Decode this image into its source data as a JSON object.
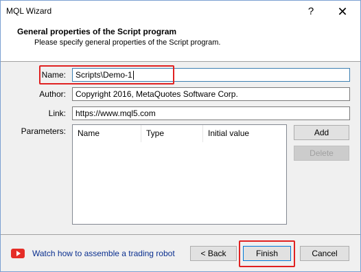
{
  "window": {
    "title": "MQL Wizard",
    "help": "?",
    "close": "✕"
  },
  "header": {
    "title": "General properties of the Script program",
    "subtitle": "Please specify general properties of the Script program."
  },
  "form": {
    "name_label": "Name:",
    "name_value": "Scripts\\Demo-1",
    "author_label": "Author:",
    "author_value": "Copyright 2016, MetaQuotes Software Corp.",
    "link_label": "Link:",
    "link_value": "https://www.mql5.com",
    "parameters_label": "Parameters:"
  },
  "parameters": {
    "columns": [
      "Name",
      "Type",
      "Initial value"
    ],
    "rows": []
  },
  "buttons": {
    "add": "Add",
    "delete": "Delete",
    "back": "< Back",
    "finish": "Finish",
    "cancel": "Cancel"
  },
  "footer": {
    "watch_link": "Watch how to assemble a trading robot",
    "icon": "youtube-play-icon"
  },
  "colors": {
    "highlight": "#e02020",
    "link": "#0a2f8f",
    "icon_red": "#e52d27"
  }
}
